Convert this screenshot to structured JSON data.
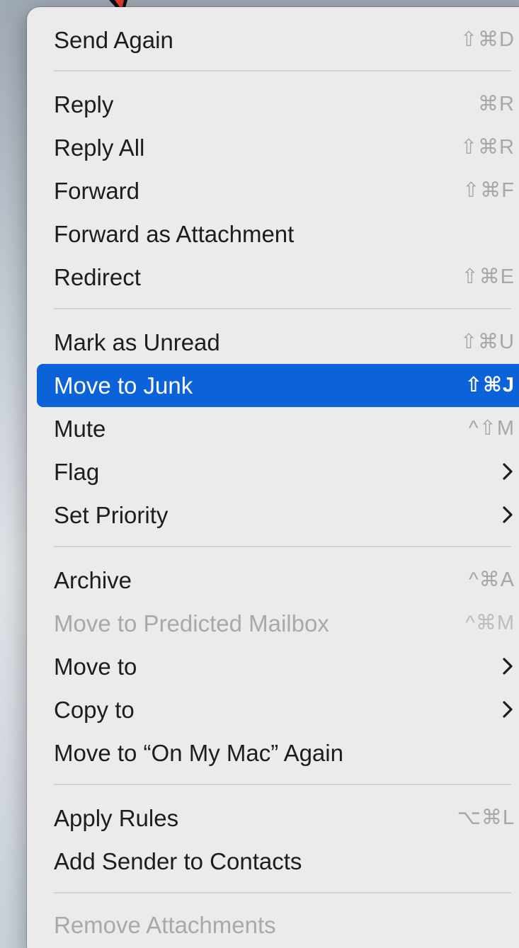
{
  "menu": {
    "items": [
      {
        "label": "Send Again",
        "shortcut": "⇧⌘D"
      },
      {
        "label": "Reply",
        "shortcut": "⌘R"
      },
      {
        "label": "Reply All",
        "shortcut": "⇧⌘R"
      },
      {
        "label": "Forward",
        "shortcut": "⇧⌘F"
      },
      {
        "label": "Forward as Attachment",
        "shortcut": ""
      },
      {
        "label": "Redirect",
        "shortcut": "⇧⌘E"
      },
      {
        "label": "Mark as Unread",
        "shortcut": "⇧⌘U"
      },
      {
        "label": "Move to Junk",
        "shortcut": "⇧⌘J",
        "state": "highlighted"
      },
      {
        "label": "Mute",
        "shortcut": "^⇧M"
      },
      {
        "label": "Flag",
        "submenu_icon": "chevron-right-icon"
      },
      {
        "label": "Set Priority",
        "submenu_icon": "chevron-right-icon"
      },
      {
        "label": "Archive",
        "shortcut": "^⌘A"
      },
      {
        "label": "Move to Predicted Mailbox",
        "shortcut": "^⌘M",
        "state": "disabled"
      },
      {
        "label": "Move to",
        "submenu_icon": "chevron-right-icon"
      },
      {
        "label": "Copy to",
        "submenu_icon": "chevron-right-icon"
      },
      {
        "label": "Move to “On My Mac” Again",
        "shortcut": ""
      },
      {
        "label": "Apply Rules",
        "shortcut": "⌥⌘L"
      },
      {
        "label": "Add Sender to Contacts",
        "shortcut": ""
      },
      {
        "label": "Remove Attachments",
        "shortcut": "",
        "state": "disabled"
      }
    ]
  },
  "colors": {
    "menu_background": "#ebebeb",
    "highlight": "#0b62d9",
    "text": "#1d1d1f",
    "disabled_text": "#a9a9a9",
    "shortcut_text": "#a7a7a7",
    "separator": "#d2d2d2",
    "cursor_fill": "#e8382f"
  }
}
